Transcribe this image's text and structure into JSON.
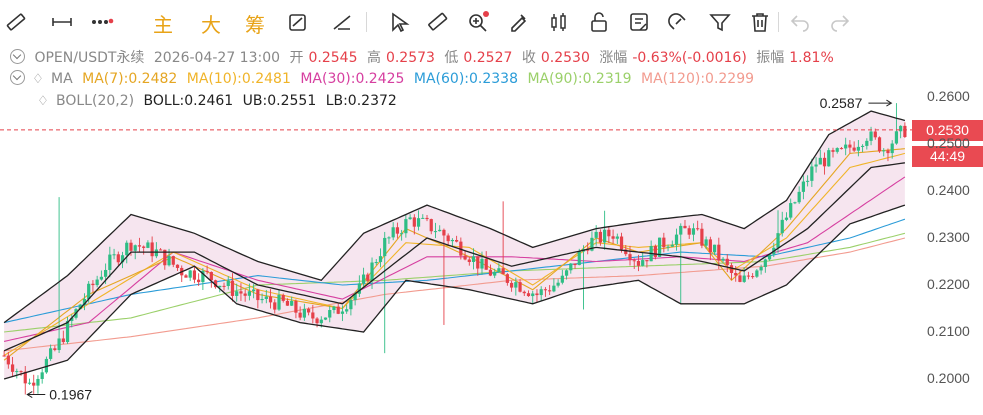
{
  "toolbar": {
    "icons": [
      "ruler-icon",
      "horizontal-line-icon",
      "more-dots-icon",
      "grid-icon",
      "zoom-icon",
      "measure-icon",
      "brush-icon",
      "candle-icon",
      "lock-icon",
      "note-icon",
      "magnet-icon",
      "filter-icon",
      "trash-icon",
      "undo-icon",
      "redo-icon"
    ],
    "main_label": "主",
    "big_label": "大",
    "chip_label": "筹"
  },
  "info": {
    "symbol": "OPEN/USDT永续",
    "datetime": "2026-04-27 13:00",
    "open_label": "开",
    "open": "0.2545",
    "high_label": "高",
    "high": "0.2573",
    "low_label": "低",
    "low": "0.2527",
    "close_label": "收",
    "close": "0.2530",
    "change_label": "涨幅",
    "change": "-0.63%(-0.0016)",
    "amp_label": "振幅",
    "amp": "1.81%"
  },
  "ma": {
    "label": "MA",
    "ma7": "MA(7):0.2482",
    "ma10": "MA(10):0.2481",
    "ma30": "MA(30):0.2425",
    "ma60": "MA(60):0.2338",
    "ma90": "MA(90):0.2319",
    "ma120": "MA(120):0.2299",
    "colors": {
      "ma7": "#e5a623",
      "ma10": "#f0b429",
      "ma30": "#d63fa0",
      "ma60": "#2b9cd8",
      "ma90": "#9bd06a",
      "ma120": "#f29b8f"
    }
  },
  "boll": {
    "label": "BOLL(20,2)",
    "mid": "BOLL:0.2461",
    "ub": "UB:0.2551",
    "lb": "LB:0.2372"
  },
  "price_tag": {
    "price": "0.2530",
    "countdown": "44:49"
  },
  "chart_data": {
    "type": "candlestick",
    "y_ticks": [
      "0.2600",
      "0.2500",
      "0.2400",
      "0.2300",
      "0.2200",
      "0.2100",
      "0.2000"
    ],
    "ylim": [
      0.1962,
      0.2677
    ],
    "last_price": 0.253,
    "high_marker": "0.2587",
    "low_marker": "0.1967",
    "colors": {
      "up": "#2ebd85",
      "down": "#e5404a",
      "band_fill": "#f3dce9",
      "band_line": "#222222"
    },
    "close_path": [
      [
        0,
        0.205
      ],
      [
        6,
        0.199
      ],
      [
        12,
        0.206
      ],
      [
        18,
        0.216
      ],
      [
        24,
        0.224
      ],
      [
        30,
        0.229
      ],
      [
        36,
        0.227
      ],
      [
        42,
        0.223
      ],
      [
        48,
        0.222
      ],
      [
        54,
        0.219
      ],
      [
        60,
        0.217
      ],
      [
        66,
        0.216
      ],
      [
        72,
        0.213
      ],
      [
        78,
        0.214
      ],
      [
        84,
        0.219
      ],
      [
        90,
        0.229
      ],
      [
        96,
        0.234
      ],
      [
        102,
        0.232
      ],
      [
        108,
        0.228
      ],
      [
        114,
        0.223
      ],
      [
        120,
        0.221
      ],
      [
        126,
        0.218
      ],
      [
        132,
        0.221
      ],
      [
        138,
        0.229
      ],
      [
        144,
        0.231
      ],
      [
        150,
        0.225
      ],
      [
        156,
        0.229
      ],
      [
        162,
        0.232
      ],
      [
        168,
        0.227
      ],
      [
        174,
        0.22
      ],
      [
        180,
        0.226
      ],
      [
        186,
        0.236
      ],
      [
        192,
        0.246
      ],
      [
        198,
        0.248
      ],
      [
        204,
        0.252
      ],
      [
        208,
        0.249
      ],
      [
        213,
        0.253
      ]
    ],
    "highs": [
      [
        13,
        0.2387
      ],
      [
        118,
        0.2378
      ],
      [
        142,
        0.2358
      ],
      [
        183,
        0.2359
      ],
      [
        211,
        0.2587
      ]
    ],
    "lows": [
      [
        5,
        0.1967
      ],
      [
        90,
        0.2055
      ],
      [
        104,
        0.2115
      ],
      [
        137,
        0.2148
      ],
      [
        160,
        0.2161
      ]
    ],
    "ma_paths": {
      "ma7": [
        [
          0,
          0.204
        ],
        [
          20,
          0.218
        ],
        [
          40,
          0.226
        ],
        [
          60,
          0.218
        ],
        [
          80,
          0.215
        ],
        [
          95,
          0.232
        ],
        [
          110,
          0.226
        ],
        [
          125,
          0.219
        ],
        [
          140,
          0.23
        ],
        [
          150,
          0.227
        ],
        [
          165,
          0.229
        ],
        [
          172,
          0.221
        ],
        [
          185,
          0.232
        ],
        [
          200,
          0.248
        ],
        [
          213,
          0.249
        ]
      ],
      "ma10": [
        [
          0,
          0.205
        ],
        [
          20,
          0.216
        ],
        [
          40,
          0.227
        ],
        [
          60,
          0.219
        ],
        [
          80,
          0.215
        ],
        [
          95,
          0.229
        ],
        [
          110,
          0.228
        ],
        [
          125,
          0.22
        ],
        [
          140,
          0.229
        ],
        [
          150,
          0.228
        ],
        [
          165,
          0.229
        ],
        [
          172,
          0.223
        ],
        [
          185,
          0.23
        ],
        [
          200,
          0.245
        ],
        [
          213,
          0.248
        ]
      ],
      "ma30": [
        [
          0,
          0.208
        ],
        [
          20,
          0.212
        ],
        [
          40,
          0.227
        ],
        [
          60,
          0.221
        ],
        [
          80,
          0.217
        ],
        [
          100,
          0.226
        ],
        [
          120,
          0.226
        ],
        [
          140,
          0.225
        ],
        [
          160,
          0.226
        ],
        [
          175,
          0.225
        ],
        [
          190,
          0.229
        ],
        [
          213,
          0.243
        ]
      ],
      "ma60": [
        [
          0,
          0.212
        ],
        [
          30,
          0.218
        ],
        [
          60,
          0.222
        ],
        [
          80,
          0.22
        ],
        [
          100,
          0.221
        ],
        [
          130,
          0.224
        ],
        [
          160,
          0.227
        ],
        [
          180,
          0.226
        ],
        [
          200,
          0.23
        ],
        [
          213,
          0.234
        ]
      ],
      "ma90": [
        [
          0,
          0.21
        ],
        [
          30,
          0.213
        ],
        [
          60,
          0.22
        ],
        [
          90,
          0.221
        ],
        [
          120,
          0.223
        ],
        [
          150,
          0.224
        ],
        [
          180,
          0.225
        ],
        [
          200,
          0.228
        ],
        [
          213,
          0.231
        ]
      ],
      "ma120": [
        [
          0,
          0.206
        ],
        [
          30,
          0.209
        ],
        [
          60,
          0.213
        ],
        [
          90,
          0.218
        ],
        [
          120,
          0.221
        ],
        [
          150,
          0.222
        ],
        [
          180,
          0.224
        ],
        [
          200,
          0.227
        ],
        [
          213,
          0.23
        ]
      ]
    },
    "boll_mid": [
      [
        0,
        0.206
      ],
      [
        15,
        0.212
      ],
      [
        30,
        0.227
      ],
      [
        45,
        0.227
      ],
      [
        60,
        0.22
      ],
      [
        80,
        0.216
      ],
      [
        100,
        0.23
      ],
      [
        120,
        0.224
      ],
      [
        140,
        0.228
      ],
      [
        160,
        0.226
      ],
      [
        175,
        0.223
      ],
      [
        190,
        0.232
      ],
      [
        205,
        0.245
      ],
      [
        213,
        0.246
      ]
    ],
    "boll_upper": [
      [
        0,
        0.212
      ],
      [
        15,
        0.222
      ],
      [
        30,
        0.235
      ],
      [
        45,
        0.231
      ],
      [
        60,
        0.225
      ],
      [
        75,
        0.221
      ],
      [
        85,
        0.231
      ],
      [
        100,
        0.237
      ],
      [
        115,
        0.232
      ],
      [
        125,
        0.228
      ],
      [
        140,
        0.232
      ],
      [
        155,
        0.234
      ],
      [
        165,
        0.235
      ],
      [
        175,
        0.232
      ],
      [
        185,
        0.238
      ],
      [
        195,
        0.252
      ],
      [
        205,
        0.257
      ],
      [
        213,
        0.255
      ]
    ],
    "boll_lower": [
      [
        0,
        0.2
      ],
      [
        15,
        0.204
      ],
      [
        30,
        0.218
      ],
      [
        45,
        0.224
      ],
      [
        55,
        0.216
      ],
      [
        70,
        0.212
      ],
      [
        85,
        0.21
      ],
      [
        95,
        0.221
      ],
      [
        110,
        0.219
      ],
      [
        125,
        0.216
      ],
      [
        135,
        0.219
      ],
      [
        150,
        0.221
      ],
      [
        160,
        0.216
      ],
      [
        175,
        0.216
      ],
      [
        185,
        0.22
      ],
      [
        200,
        0.233
      ],
      [
        213,
        0.237
      ]
    ]
  }
}
